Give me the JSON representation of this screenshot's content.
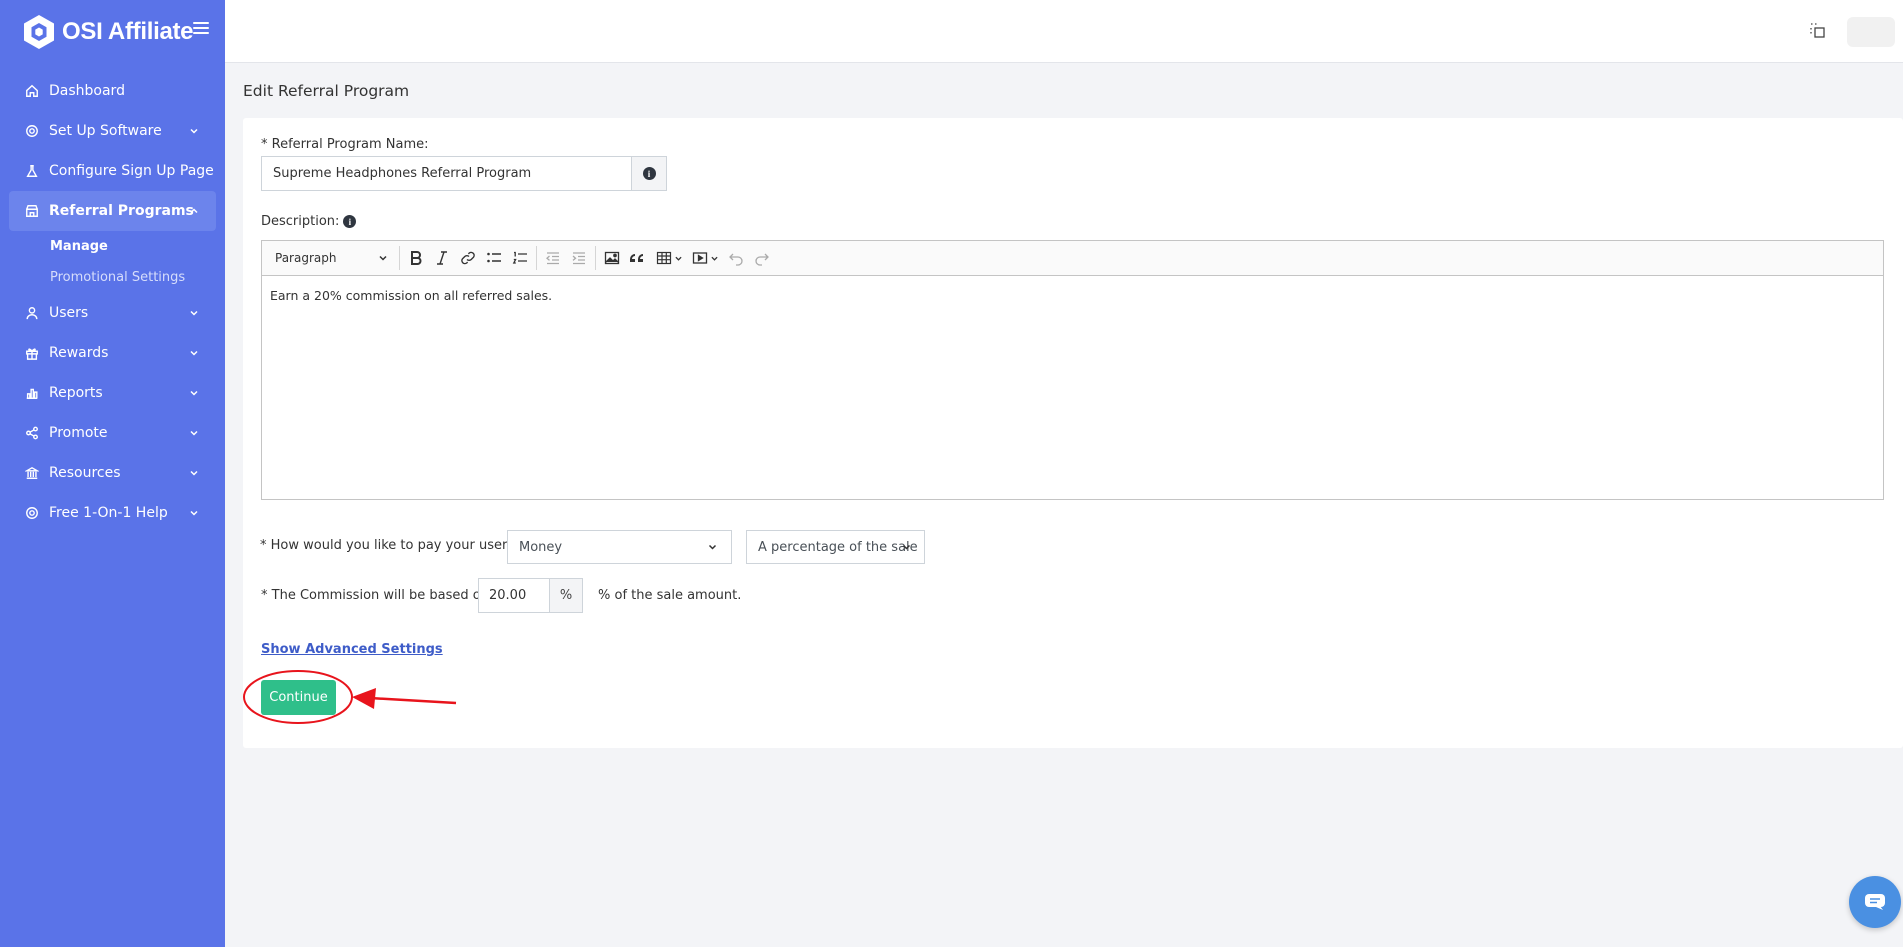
{
  "app": {
    "name": "OSI Affiliate"
  },
  "sidebar": {
    "items": [
      {
        "label": "Dashboard",
        "icon": "home-icon"
      },
      {
        "label": "Set Up Software",
        "icon": "gear-icon"
      },
      {
        "label": "Configure Sign Up Page",
        "icon": "flask-icon"
      },
      {
        "label": "Referral Programs",
        "icon": "store-icon"
      },
      {
        "label": "Users",
        "icon": "user-icon"
      },
      {
        "label": "Rewards",
        "icon": "gift-icon"
      },
      {
        "label": "Reports",
        "icon": "bar-chart-icon"
      },
      {
        "label": "Promote",
        "icon": "share-icon"
      },
      {
        "label": "Resources",
        "icon": "bank-icon"
      },
      {
        "label": "Free 1-On-1 Help",
        "icon": "lifebuoy-icon"
      }
    ],
    "subitems": [
      {
        "label": "Manage"
      },
      {
        "label": "Promotional Settings"
      }
    ]
  },
  "page": {
    "title": "Edit Referral Program"
  },
  "form": {
    "name_label": "* Referral Program Name:",
    "name_value": "Supreme Headphones Referral Program",
    "description_label": "Description:",
    "editor": {
      "block_format": "Paragraph",
      "content": "Earn a 20% commission on all referred sales."
    },
    "pay_label": "* How would you like to pay your users:",
    "pay_type": "Money",
    "pay_basis": "A percentage of the sale",
    "commission_label": "* The Commission will be based on",
    "commission_value": "20.00",
    "commission_unit": "%",
    "commission_suffix": "% of the sale amount.",
    "advanced_link": "Show Advanced Settings",
    "continue_label": "Continue"
  },
  "colors": {
    "sidebar": "#5a73e8",
    "active_nav": "#6c84ec",
    "primary_button": "#2fbf8a",
    "annotation": "#e8141c",
    "link": "#3e5cc8"
  }
}
